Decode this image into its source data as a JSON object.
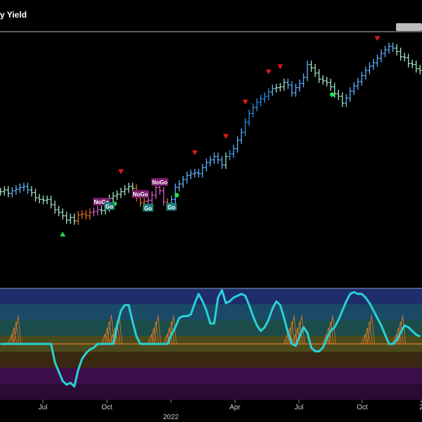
{
  "chart_data": [
    {
      "type": "ohlc",
      "title": "y Yield",
      "x_ticks": [
        "Jul",
        "Oct",
        "2022",
        "Apr",
        "Jul",
        "Oct",
        "2"
      ],
      "x_range": [
        "2021-05-01",
        "2023-01-10"
      ],
      "close_series": [
        1.57,
        1.59,
        1.55,
        1.58,
        1.6,
        1.62,
        1.63,
        1.59,
        1.56,
        1.5,
        1.48,
        1.47,
        1.48,
        1.42,
        1.36,
        1.33,
        1.29,
        1.24,
        1.27,
        1.23,
        1.3,
        1.31,
        1.29,
        1.33,
        1.34,
        1.36,
        1.35,
        1.38,
        1.49,
        1.52,
        1.54,
        1.57,
        1.6,
        1.63,
        1.61,
        1.5,
        1.44,
        1.46,
        1.47,
        1.53,
        1.62,
        1.58,
        1.45,
        1.43,
        1.48,
        1.62,
        1.66,
        1.71,
        1.76,
        1.78,
        1.79,
        1.78,
        1.85,
        1.91,
        1.94,
        1.98,
        1.94,
        1.88,
        1.98,
        2.01,
        2.07,
        2.17,
        2.26,
        2.38,
        2.48,
        2.55,
        2.61,
        2.65,
        2.68,
        2.73,
        2.77,
        2.78,
        2.79,
        2.84,
        2.81,
        2.72,
        2.78,
        2.83,
        2.9,
        3.05,
        3.01,
        2.95,
        2.88,
        2.86,
        2.84,
        2.79,
        2.71,
        2.68,
        2.6,
        2.66,
        2.74,
        2.8,
        2.85,
        2.92,
        2.98,
        3.03,
        3.07,
        3.12,
        3.18,
        3.22,
        3.26,
        3.24,
        3.2,
        3.14,
        3.13,
        3.06,
        3.05,
        3.0,
        2.98
      ],
      "bar_colors": {
        "strong_go": "#2e8fe6",
        "go": "#5fb2ff",
        "weak": "#a5e8c6",
        "nogo": "#e06c2a",
        "strong_nogo": "#d75ac8"
      },
      "bar_states": [
        "weak",
        "weak",
        "weak",
        "go",
        "go",
        "go",
        "go",
        "go",
        "weak",
        "weak",
        "weak",
        "weak",
        "weak",
        "weak",
        "weak",
        "weak",
        "weak",
        "weak",
        "weak",
        "weak",
        "nogo",
        "nogo",
        "nogo",
        "nogo",
        "strong_nogo",
        "strong_nogo",
        "weak",
        "weak",
        "weak",
        "weak",
        "weak",
        "weak",
        "weak",
        "weak",
        "weak",
        "nogo",
        "nogo",
        "nogo",
        "strong_nogo",
        "strong_nogo",
        "strong_nogo",
        "strong_nogo",
        "strong_nogo",
        "nogo",
        "go",
        "go",
        "go",
        "go",
        "go",
        "go",
        "go",
        "go",
        "go",
        "go",
        "go",
        "go",
        "go",
        "go",
        "weak",
        "strong_go",
        "go",
        "go",
        "go",
        "strong_go",
        "strong_go",
        "strong_go",
        "strong_go",
        "strong_go",
        "strong_go",
        "strong_go",
        "go",
        "weak",
        "weak",
        "weak",
        "go",
        "go",
        "go",
        "go",
        "go",
        "go",
        "weak",
        "weak",
        "weak",
        "weak",
        "weak",
        "weak",
        "weak",
        "weak",
        "weak",
        "go",
        "go",
        "go",
        "go",
        "go",
        "go",
        "go",
        "go",
        "go",
        "go",
        "go",
        "go",
        "go",
        "weak",
        "weak",
        "weak",
        "weak",
        "weak",
        "weak",
        "weak"
      ],
      "annotations": [
        {
          "label": "NoGo",
          "index": 26
        },
        {
          "label": "Go",
          "index": 28
        },
        {
          "label": "NoGo",
          "index": 36
        },
        {
          "label": "Go",
          "index": 38
        },
        {
          "label": "NoGo",
          "index": 41
        },
        {
          "label": "Go",
          "index": 44
        }
      ],
      "down_arrows": [
        31,
        50,
        58,
        63,
        69,
        72,
        97
      ],
      "up_arrows": [
        16
      ],
      "green_dots": [
        29,
        45,
        85
      ]
    },
    {
      "type": "line",
      "series": [
        {
          "values": [
            0,
            0,
            0,
            0,
            0,
            0,
            0,
            0,
            0,
            0,
            0,
            0,
            0,
            0,
            -1,
            -1.5,
            -2,
            -2.2,
            -2.1,
            -2.3,
            -1.4,
            -0.8,
            -0.5,
            -0.3,
            -0.2,
            0,
            0,
            0,
            0,
            0,
            1,
            1.8,
            2.1,
            2.1,
            1.2,
            0.4,
            0,
            0,
            0,
            0,
            0,
            0,
            0,
            0,
            0.5,
            0.9,
            1.4,
            1.5,
            1.5,
            1.6,
            2.2,
            2.7,
            2.3,
            1.8,
            1.1,
            1.1,
            2.5,
            2.9,
            2.2,
            2.3,
            2.5,
            2.6,
            2.7,
            2.6,
            2.1,
            1.5,
            1.0,
            0.7,
            0.9,
            1.3,
            1.9,
            2.3,
            2.1,
            1.4,
            0.6,
            0.0,
            -0.1,
            0.4,
            0.9,
            0.6,
            -0.2,
            -0.4,
            -0.4,
            -0.2,
            0.3,
            0.7,
            0.9,
            1.3,
            1.8,
            2.3,
            2.7,
            2.8,
            2.7,
            2.7,
            2.5,
            2.2,
            1.8,
            1.4,
            1.0,
            0.5,
            0.0,
            0.0,
            0.2,
            0.6,
            1.0,
            0.9,
            0.7,
            0.5,
            0.4
          ]
        }
      ],
      "ylim": [
        -3,
        3
      ],
      "zones": [
        {
          "color": "#1f2d6a"
        },
        {
          "color": "#1a4a66"
        },
        {
          "color": "#1c4c49"
        },
        {
          "color": "#4a4a1c"
        },
        {
          "color": "#3a2712"
        },
        {
          "color": "#3d0f4a"
        },
        {
          "color": "#2b0a33"
        }
      ],
      "zero_line_color": "#e07a2a",
      "oscillator_color": "#29d1d6",
      "spike_color": "#e07a2a"
    }
  ]
}
